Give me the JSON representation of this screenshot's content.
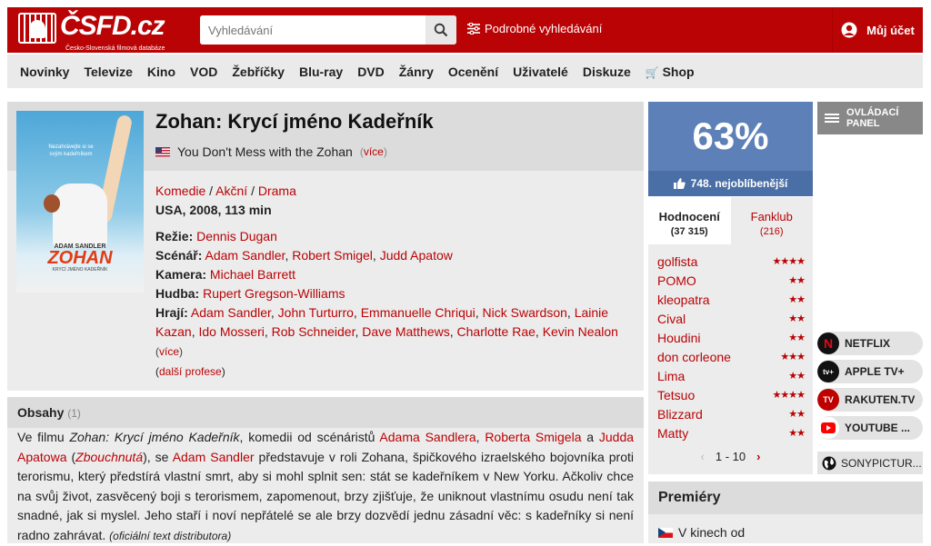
{
  "header": {
    "logo_text": "ČSFD.cz",
    "logo_sub": "Česko-Slovenská filmová databáze",
    "search_placeholder": "Vyhledávání",
    "advanced_search": "Podrobné vyhledávání",
    "account": "Můj účet"
  },
  "nav": [
    "Novinky",
    "Televize",
    "Kino",
    "VOD",
    "Žebříčky",
    "Blu-ray",
    "DVD",
    "Žánry",
    "Ocenění",
    "Uživatelé",
    "Diskuze",
    "Shop"
  ],
  "film": {
    "title": "Zohan: Krycí jméno Kadeřník",
    "original_title": "You Don't Mess with the Zohan",
    "more": "více",
    "poster": {
      "tagline": "Nezahrávejte si se svým kadeřníkem",
      "actor": "ADAM SANDLER",
      "title": "ZOHAN",
      "subtitle": "KRYCÍ JMÉNO KADEŘNÍK"
    },
    "genres": [
      "Komedie",
      "Akční",
      "Drama"
    ],
    "origin": "USA, 2008, 113 min",
    "director_label": "Režie:",
    "director": "Dennis Dugan",
    "writer_label": "Scénář:",
    "writers": [
      "Adam Sandler",
      "Robert Smigel",
      "Judd Apatow"
    ],
    "camera_label": "Kamera:",
    "camera": "Michael Barrett",
    "music_label": "Hudba:",
    "music": "Rupert Gregson-Williams",
    "cast_label": "Hrají:",
    "cast": [
      "Adam Sandler",
      "John Turturro",
      "Emmanuelle Chriqui",
      "Nick Swardson",
      "Lainie Kazan",
      "Ido Mosseri",
      "Rob Schneider",
      "Dave Matthews",
      "Charlotte Rae",
      "Kevin Nealon"
    ],
    "more_cast": "více",
    "more_professions": "další profese"
  },
  "plot": {
    "heading": "Obsahy",
    "count": "(1)",
    "p1": "Ve filmu ",
    "film": "Zohan: Krycí jméno Kadeřník",
    "p2": ", komedii od scénáristů ",
    "w1": "Adama Sandlera",
    "sep1": ", ",
    "w2": "Roberta Smigela",
    "and": " a ",
    "w3": "Judda Apatowa",
    "open": " (",
    "w3film": "Zbouchnutá",
    "close": "), se ",
    "actor": "Adam Sandler",
    "p3": " představuje v roli Zohana, špičkového izraelského bojovníka proti terorismu, který předstírá vlastní smrt, aby si mohl splnit sen: stát se kadeřníkem v New Yorku. Ačkoliv chce na svůj život, zasvěcený boji s terorismem, zapomenout, brzy zjišťuje, že uniknout vlastnímu osudu není tak snadné, jak si myslel. Jeho staří i noví nepřátelé se ale brzy dozvědí jednu zásadní věc: s kadeřníky si není radno zahrávat. ",
    "source": "(oficiální text distributora)"
  },
  "rating": {
    "percent": "63%",
    "rank": "748. nejoblíbenější",
    "color": "#5c80b7"
  },
  "tabs": {
    "rating_label": "Hodnocení",
    "rating_count": "(37 315)",
    "fanklub_label": "Fanklub",
    "fanklub_count": "(216)"
  },
  "user_ratings": [
    {
      "user": "golfista",
      "stars": 4
    },
    {
      "user": "POMO",
      "stars": 2
    },
    {
      "user": "kleopatra",
      "stars": 2
    },
    {
      "user": "Cival",
      "stars": 2
    },
    {
      "user": "Houdini",
      "stars": 2
    },
    {
      "user": "don corleone",
      "stars": 3
    },
    {
      "user": "Lima",
      "stars": 2
    },
    {
      "user": "Tetsuo",
      "stars": 4
    },
    {
      "user": "Blizzard",
      "stars": 2
    },
    {
      "user": "Matty",
      "stars": 2
    }
  ],
  "pager": {
    "range": "1 - 10"
  },
  "sidebar": {
    "control_panel": "OVLÁDACÍ PANEL",
    "vod": [
      "NETFLIX",
      "APPLE TV+",
      "RAKUTEN.TV",
      "YOUTUBE ...",
      "SONYPICTUR..."
    ]
  },
  "premiere": {
    "heading": "Premiéry",
    "line": "V kinech od"
  }
}
